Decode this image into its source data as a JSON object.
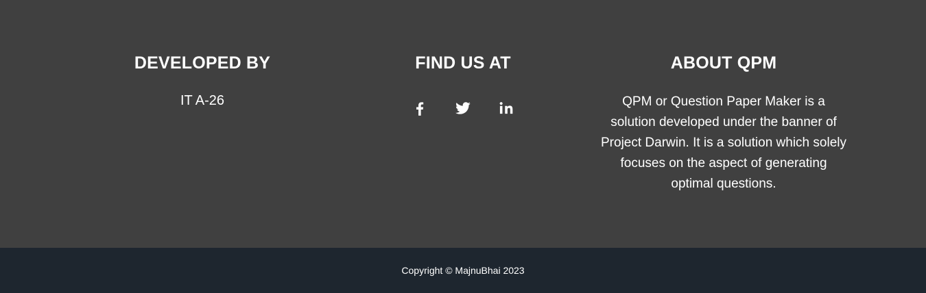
{
  "developed": {
    "title": "DEVELOPED BY",
    "text": "IT A-26"
  },
  "find": {
    "title": "FIND US AT",
    "links": [
      {
        "icon": "facebook-icon"
      },
      {
        "icon": "twitter-icon"
      },
      {
        "icon": "linkedin-icon"
      }
    ]
  },
  "about": {
    "title": "ABOUT QPM",
    "text": "QPM or Question Paper Maker is a solution developed under the banner of Project Darwin. It is a solution which solely focuses on the aspect of generating optimal questions."
  },
  "copyright": "Copyright © MajnuBhai 2023",
  "colors": {
    "footer_bg": "#404040",
    "bottom_bg": "#1e262f",
    "text": "#ffffff"
  }
}
